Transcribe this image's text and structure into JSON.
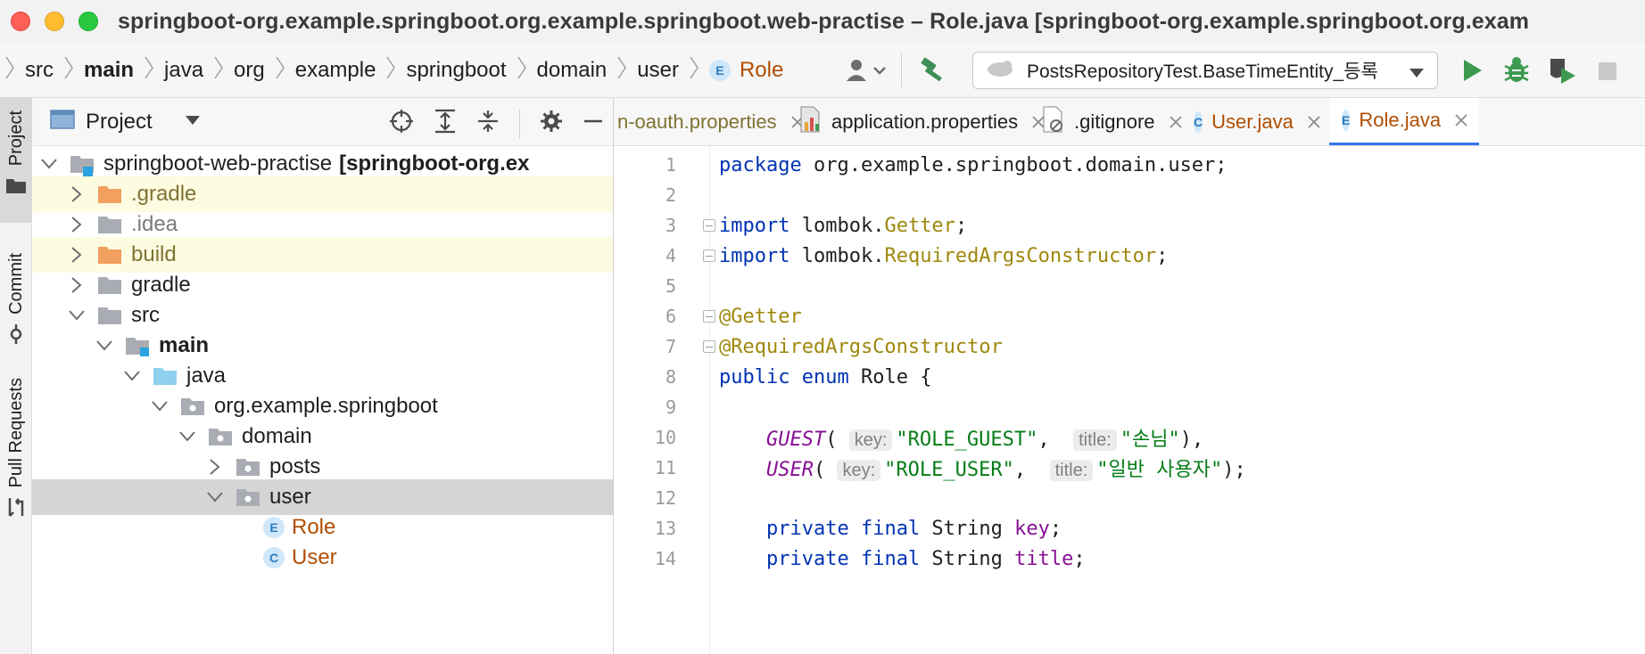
{
  "window": {
    "title": "springboot-org.example.springboot.org.example.springboot.web-practise – Role.java [springboot-org.example.springboot.org.exam"
  },
  "breadcrumbs": [
    {
      "label": "src",
      "bold": false
    },
    {
      "label": "main",
      "bold": true
    },
    {
      "label": "java",
      "bold": false
    },
    {
      "label": "org",
      "bold": false
    },
    {
      "label": "example",
      "bold": false
    },
    {
      "label": "springboot",
      "bold": false
    },
    {
      "label": "domain",
      "bold": false
    },
    {
      "label": "user",
      "bold": false
    }
  ],
  "breadcrumb_current": {
    "badge": "E",
    "label": "Role"
  },
  "run_config": {
    "label": "PostsRepositoryTest.BaseTimeEntity_등록"
  },
  "side_tabs": {
    "project": "Project",
    "commit": "Commit",
    "pull_requests": "Pull Requests"
  },
  "project_panel": {
    "title": "Project",
    "tree": [
      {
        "label": "springboot-web-practise",
        "suffix": "[springboot-org.ex",
        "depth": 0,
        "expanded": true,
        "type": "module",
        "style": "normal"
      },
      {
        "label": ".gradle",
        "depth": 1,
        "expanded": false,
        "type": "folder-orange",
        "style": "yellow",
        "highlight": true
      },
      {
        "label": ".idea",
        "depth": 1,
        "expanded": false,
        "type": "folder-gray",
        "style": "muted"
      },
      {
        "label": "build",
        "depth": 1,
        "expanded": false,
        "type": "folder-orange",
        "style": "yellow",
        "highlight": true
      },
      {
        "label": "gradle",
        "depth": 1,
        "expanded": false,
        "type": "folder-gray",
        "style": "normal"
      },
      {
        "label": "src",
        "depth": 1,
        "expanded": true,
        "type": "folder-gray",
        "style": "normal"
      },
      {
        "label": "main",
        "depth": 2,
        "expanded": true,
        "type": "folder-module",
        "style": "bold"
      },
      {
        "label": "java",
        "depth": 3,
        "expanded": true,
        "type": "folder-blue",
        "style": "normal"
      },
      {
        "label": "org.example.springboot",
        "depth": 4,
        "expanded": true,
        "type": "package",
        "style": "normal"
      },
      {
        "label": "domain",
        "depth": 5,
        "expanded": true,
        "type": "package",
        "style": "normal"
      },
      {
        "label": "posts",
        "depth": 6,
        "expanded": false,
        "type": "package",
        "style": "normal"
      },
      {
        "label": "user",
        "depth": 6,
        "expanded": true,
        "type": "package",
        "style": "normal",
        "selected": true
      },
      {
        "label": "Role",
        "depth": 7,
        "type": "enum",
        "badge": "E",
        "style": "orange"
      },
      {
        "label": "User",
        "depth": 7,
        "type": "class",
        "badge": "C",
        "style": "orange"
      }
    ]
  },
  "tabs": [
    {
      "label": "n-oauth.properties",
      "icon": "none",
      "style": "olive",
      "active": false
    },
    {
      "label": "application.properties",
      "icon": "properties-icon",
      "style": "normal",
      "active": false
    },
    {
      "label": ".gitignore",
      "icon": "gitignore-icon",
      "style": "normal",
      "active": false
    },
    {
      "label": "User.java",
      "icon": "C",
      "style": "orange",
      "active": false
    },
    {
      "label": "Role.java",
      "icon": "E",
      "style": "orange",
      "active": true
    }
  ],
  "editor": {
    "lines": [
      {
        "n": "1",
        "tokens": [
          [
            "kw",
            "package"
          ],
          [
            "t",
            " org.example.springboot.domain.user;"
          ]
        ]
      },
      {
        "n": "2",
        "tokens": []
      },
      {
        "n": "3",
        "fold": true,
        "tokens": [
          [
            "kw",
            "import"
          ],
          [
            "t",
            " lombok."
          ],
          [
            "cls",
            "Getter"
          ],
          [
            "t",
            ";"
          ]
        ]
      },
      {
        "n": "4",
        "fold": true,
        "tokens": [
          [
            "kw",
            "import"
          ],
          [
            "t",
            " lombok."
          ],
          [
            "cls",
            "RequiredArgsConstructor"
          ],
          [
            "t",
            ";"
          ]
        ]
      },
      {
        "n": "5",
        "tokens": []
      },
      {
        "n": "6",
        "fold": true,
        "tokens": [
          [
            "ann",
            "@Getter"
          ]
        ]
      },
      {
        "n": "7",
        "fold": true,
        "tokens": [
          [
            "ann",
            "@RequiredArgsConstructor"
          ]
        ]
      },
      {
        "n": "8",
        "tokens": [
          [
            "kw",
            "public"
          ],
          [
            "t",
            " "
          ],
          [
            "kw",
            "enum"
          ],
          [
            "t",
            " Role {"
          ]
        ]
      },
      {
        "n": "9",
        "tokens": []
      },
      {
        "n": "10",
        "tokens": [
          [
            "t",
            "    "
          ],
          [
            "enumc",
            "GUEST"
          ],
          [
            "t",
            "( "
          ],
          [
            "hint",
            "key:"
          ],
          [
            "str",
            "\"ROLE_GUEST\""
          ],
          [
            "t",
            ",  "
          ],
          [
            "hint",
            "title:"
          ],
          [
            "str",
            "\"손님\""
          ],
          [
            "t",
            "),"
          ]
        ]
      },
      {
        "n": "11",
        "tokens": [
          [
            "t",
            "    "
          ],
          [
            "enumc",
            "USER"
          ],
          [
            "t",
            "( "
          ],
          [
            "hint",
            "key:"
          ],
          [
            "str",
            "\"ROLE_USER\""
          ],
          [
            "t",
            ",  "
          ],
          [
            "hint",
            "title:"
          ],
          [
            "str",
            "\"일반 사용자\""
          ],
          [
            "t",
            ");"
          ]
        ]
      },
      {
        "n": "12",
        "tokens": []
      },
      {
        "n": "13",
        "tokens": [
          [
            "t",
            "    "
          ],
          [
            "kw",
            "private"
          ],
          [
            "t",
            " "
          ],
          [
            "kw",
            "final"
          ],
          [
            "t",
            " String "
          ],
          [
            "field",
            "key"
          ],
          [
            "t",
            ";"
          ]
        ]
      },
      {
        "n": "14",
        "tokens": [
          [
            "t",
            "    "
          ],
          [
            "kw",
            "private"
          ],
          [
            "t",
            " "
          ],
          [
            "kw",
            "final"
          ],
          [
            "t",
            " String "
          ],
          [
            "field",
            "title"
          ],
          [
            "t",
            ";"
          ]
        ]
      }
    ]
  }
}
